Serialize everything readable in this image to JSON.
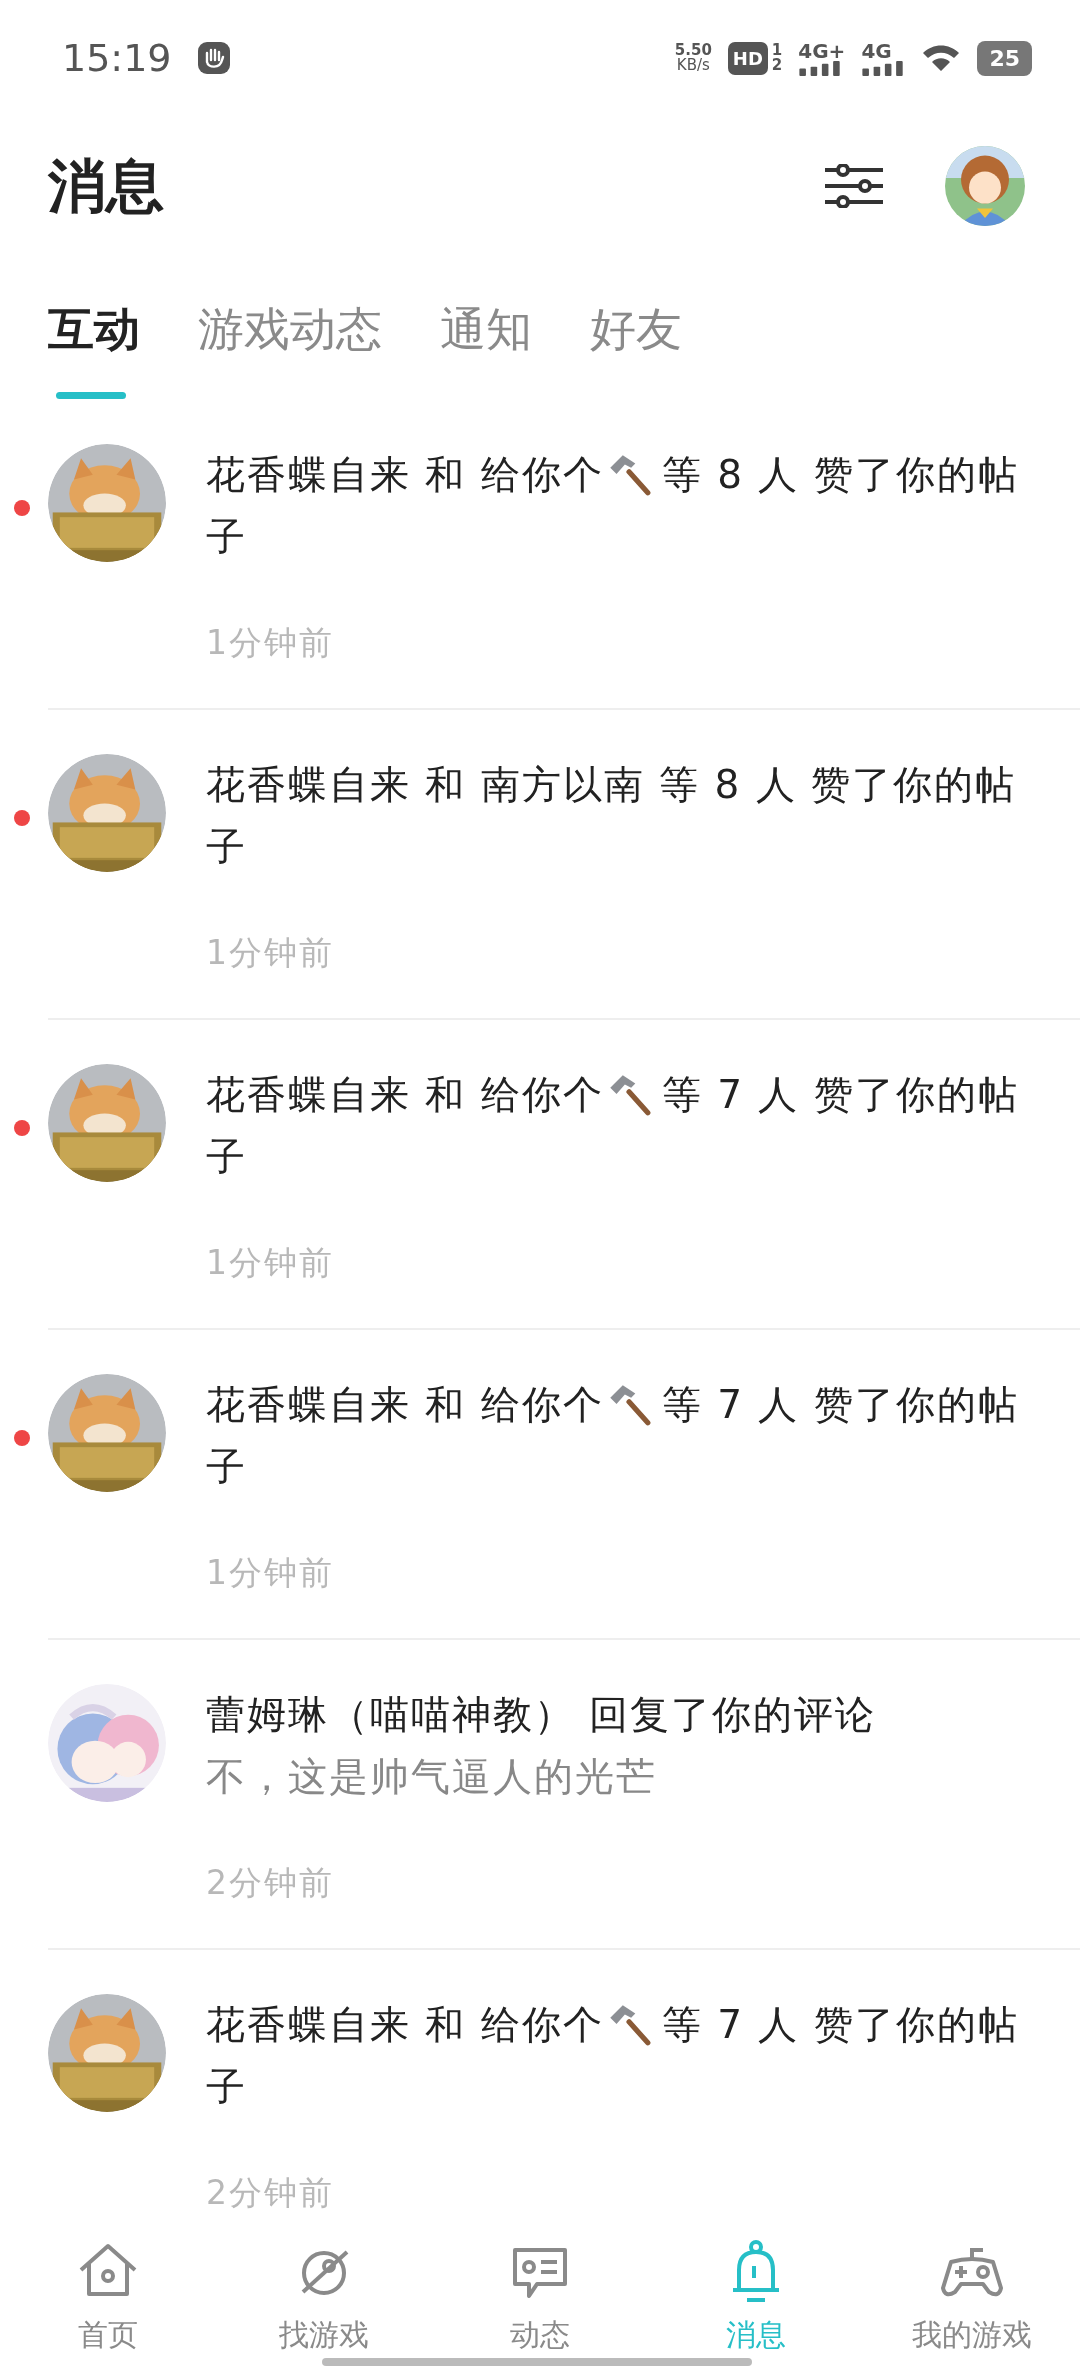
{
  "status_bar": {
    "time": "15:19",
    "speed": "5.50",
    "speed_unit": "KB/s",
    "hd": "HD",
    "sim_1": "1",
    "sim_2": "2",
    "network_1": "4G+",
    "network_2": "4G",
    "battery": "25"
  },
  "header": {
    "title": "消息"
  },
  "tabs": [
    {
      "label": "互动",
      "selected": true
    },
    {
      "label": "游戏动态",
      "selected": false
    },
    {
      "label": "通知",
      "selected": false
    },
    {
      "label": "好友",
      "selected": false
    }
  ],
  "messages": [
    {
      "kind": "like",
      "unread": true,
      "text_1": "花香蝶自来 和 给你个",
      "text_2": "等 8 人 赞了你的帖",
      "text_3": "子",
      "time": "1分钟前"
    },
    {
      "kind": "like_plain",
      "unread": true,
      "text_1": "花香蝶自来 和 南方以南 等 8 人 赞了你的帖子",
      "time": "1分钟前"
    },
    {
      "kind": "like",
      "unread": true,
      "text_1": "花香蝶自来 和 给你个",
      "text_2": "等 7 人 赞了你的帖",
      "text_3": "子",
      "time": "1分钟前"
    },
    {
      "kind": "like",
      "unread": true,
      "text_1": "花香蝶自来 和 给你个",
      "text_2": "等 7 人 赞了你的帖",
      "text_3": "子",
      "time": "1分钟前"
    },
    {
      "kind": "reply",
      "unread": false,
      "text_1": "蕾姆琳（喵喵神教） 回复了你的评论",
      "text_2": "不，这是帅气逼人的光芒",
      "time": "2分钟前"
    },
    {
      "kind": "like",
      "unread": false,
      "text_1": "花香蝶自来 和 给你个",
      "text_2": "等 7 人 赞了你的帖",
      "text_3": "子",
      "time": "2分钟前"
    }
  ],
  "bottom_nav": [
    {
      "label": "首页",
      "selected": false
    },
    {
      "label": "找游戏",
      "selected": false
    },
    {
      "label": "动态",
      "selected": false
    },
    {
      "label": "消息",
      "selected": true
    },
    {
      "label": "我的游戏",
      "selected": false
    }
  ]
}
